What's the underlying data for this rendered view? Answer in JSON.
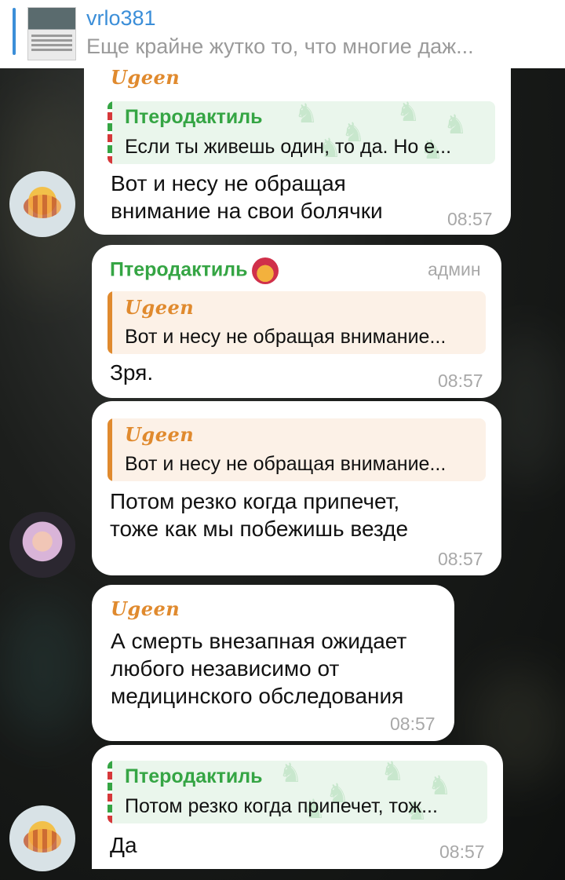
{
  "pinned": {
    "title": "vrlo381",
    "text": "Еще крайне жутко то, что многие даж..."
  },
  "messages": [
    {
      "sender": "Ugeen",
      "quote": {
        "name": "Птеродактиль",
        "text": "Если ты живешь один, то да.  Но е..."
      },
      "text_lines": [
        "Вот и несу не обращая",
        "внимание на свои болячки"
      ],
      "time": "08:57"
    },
    {
      "sender": "Птеродактиль",
      "badge": "админ",
      "quote": {
        "name": "Ugeen",
        "text": "Вот и несу не обращая внимание..."
      },
      "text_lines": [
        "Зря."
      ],
      "time": "08:57"
    },
    {
      "quote": {
        "name": "Ugeen",
        "text": "Вот и несу не обращая внимание..."
      },
      "text_lines": [
        "Потом резко когда припечет,",
        "тоже как мы побежишь везде"
      ],
      "time": "08:57"
    },
    {
      "sender": "Ugeen",
      "text_lines": [
        "А смерть внезапная ожидает",
        "любого независимо от",
        "медицинского обследования"
      ],
      "time": "08:57"
    },
    {
      "quote": {
        "name": "Птеродактиль",
        "text": "Потом резко когда припечет, тож..."
      },
      "text_lines": [
        "Да"
      ],
      "time": "08:57"
    }
  ],
  "icons": {
    "pattern": "unicorn-pattern-icon",
    "sticker": "burger-sticker-icon"
  },
  "colors": {
    "ugeen": "#e08a2e",
    "ptero": "#35a544",
    "pinned_title": "#3b8ed8"
  }
}
